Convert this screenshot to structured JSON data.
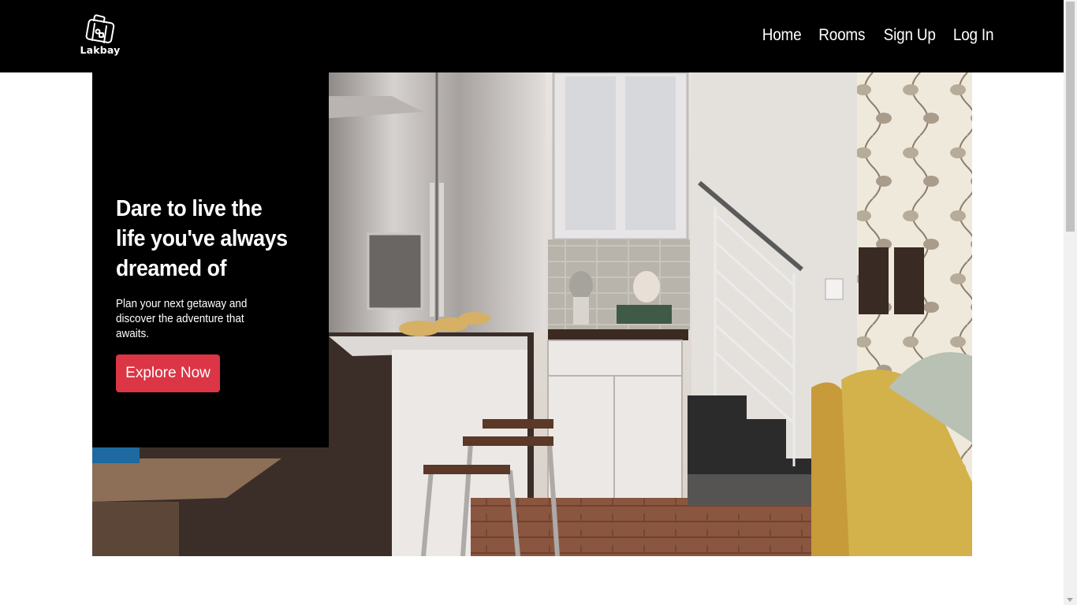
{
  "brand": {
    "name": "Lakbay",
    "logo_icon": "suitcase-icon"
  },
  "nav": {
    "items": [
      {
        "label": "Home"
      },
      {
        "label": "Rooms"
      },
      {
        "label": "Sign Up"
      },
      {
        "label": "Log In"
      }
    ]
  },
  "hero": {
    "title": "Dare to live the life you've always dreamed of",
    "subtitle": "Plan your next getaway and discover the adventure that awaits.",
    "cta_label": "Explore Now",
    "image_description_icon": "kitchen-interior-photo"
  },
  "colors": {
    "navbar_bg": "#000000",
    "cta_bg": "#dc3545",
    "card_bg": "#000000"
  }
}
